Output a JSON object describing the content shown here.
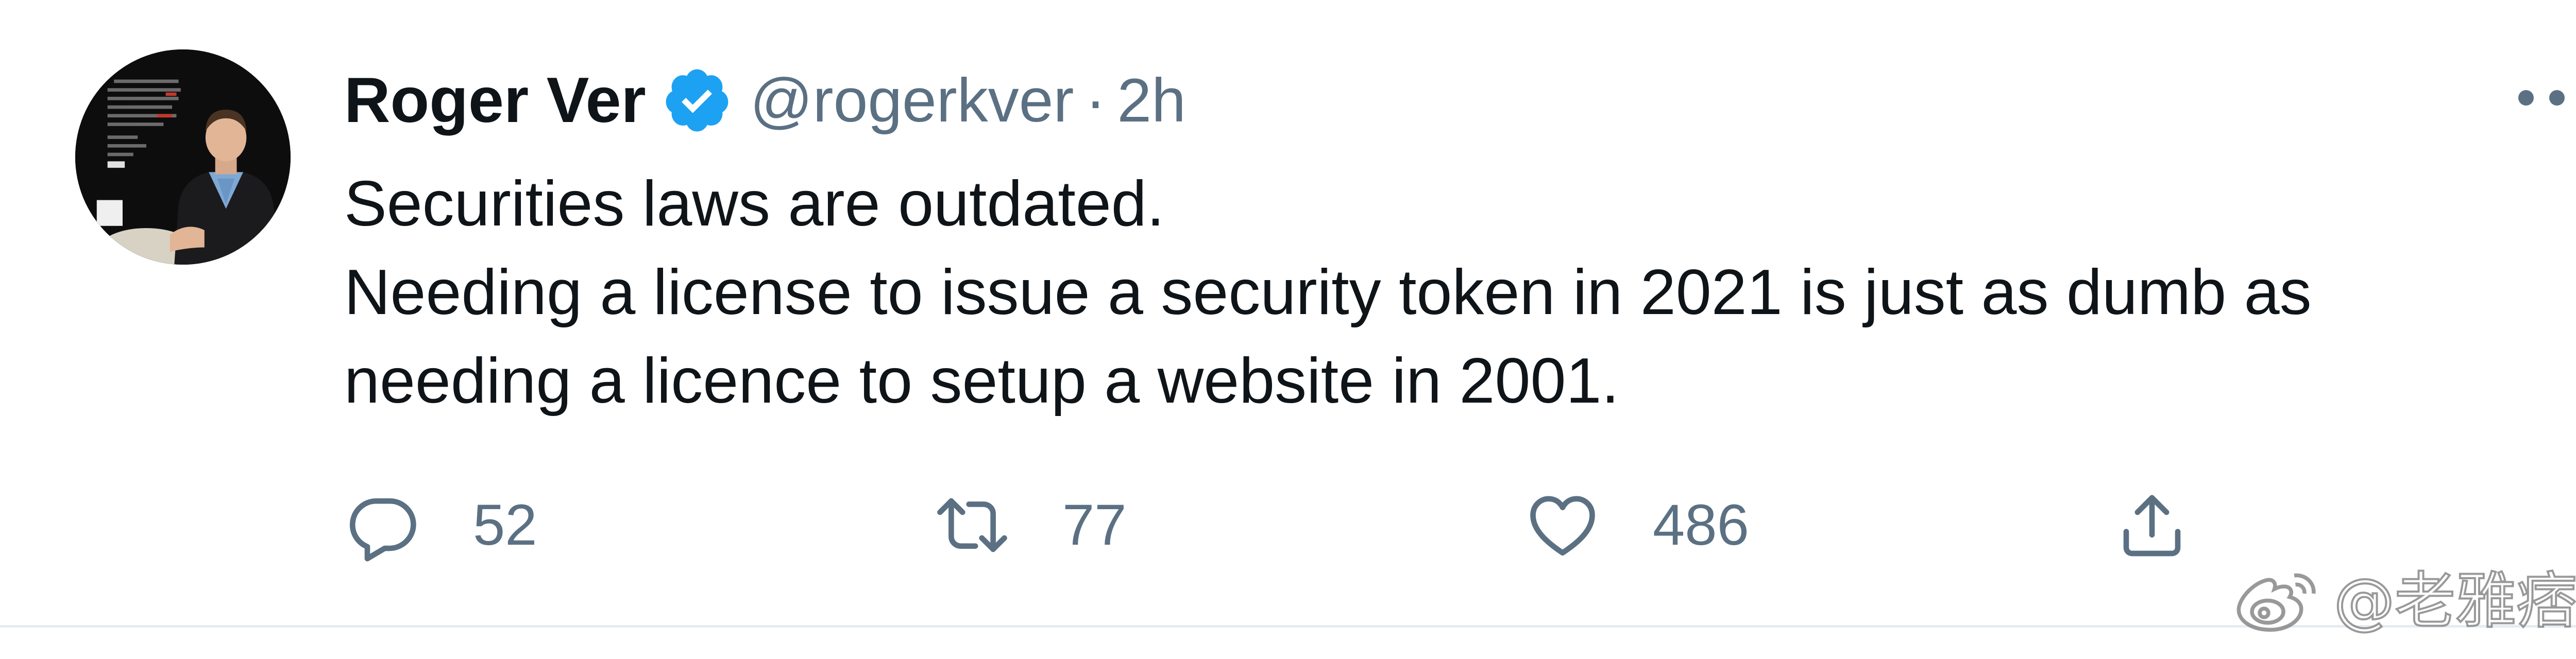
{
  "author": {
    "display_name": "Roger Ver",
    "verified": true,
    "handle": "@rogerkver",
    "separator": "·",
    "timestamp": "2h"
  },
  "tweet": {
    "lines": [
      "Securities laws are outdated.",
      "Needing a license to issue a security token in 2021 is just as dumb as",
      "needing a licence to setup a website in 2001."
    ]
  },
  "actions": {
    "reply": {
      "icon": "reply-icon",
      "count": "52"
    },
    "retweet": {
      "icon": "retweet-icon",
      "count": "77"
    },
    "like": {
      "icon": "heart-icon",
      "count": "486"
    },
    "share": {
      "icon": "share-icon"
    }
  },
  "menu": {
    "icon": "more-icon"
  },
  "watermark": {
    "text": "@老雅痞",
    "icon": "weibo-icon"
  },
  "colors": {
    "text_primary": "#0f1419",
    "text_secondary": "#5b7083",
    "verified_blue": "#1da1f2",
    "divider": "#e6ecf0",
    "background": "#ffffff"
  }
}
